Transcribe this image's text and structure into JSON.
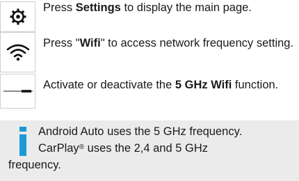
{
  "steps": [
    {
      "icon": "settings-gear-icon",
      "text_before": "Press ",
      "text_bold": "Settings",
      "text_after": " to display the main page."
    },
    {
      "icon": "wifi-icon",
      "text_before": "Press \"",
      "text_bold": "Wifi",
      "text_after": "\" to access network frequency setting."
    },
    {
      "icon": "toggle-switch-icon",
      "text_before": "Activate or deactivate the ",
      "text_bold": "5 GHz Wifi",
      "text_after": " function."
    }
  ],
  "note": {
    "icon": "info-icon",
    "line1": "Android Auto uses the 5 GHz frequency.",
    "line2_a": "CarPlay",
    "line2_reg": "®",
    "line2_b": " uses the 2,4 and 5 GHz",
    "line3": "frequency.",
    "accent_color": "#1d9ad6",
    "background": "#ebebeb"
  }
}
